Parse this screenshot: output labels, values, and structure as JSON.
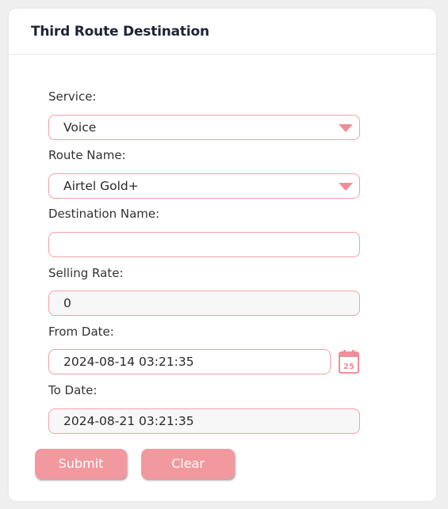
{
  "card": {
    "title": "Third Route Destination"
  },
  "form": {
    "service": {
      "label": "Service:",
      "value": "Voice"
    },
    "route_name": {
      "label": "Route Name:",
      "value": "Airtel Gold+"
    },
    "destination_name": {
      "label": "Destination Name:",
      "value": ""
    },
    "selling_rate": {
      "label": "Selling Rate:",
      "value": "0"
    },
    "from_date": {
      "label": "From Date:",
      "value": "2024-08-14 03:21:35",
      "calendar_icon_day": "25"
    },
    "to_date": {
      "label": "To Date:",
      "value": "2024-08-21 03:21:35"
    }
  },
  "buttons": {
    "submit_label": "Submit",
    "clear_label": "Clear"
  },
  "colors": {
    "accent": "#f1999f",
    "border": "#f2a0a6",
    "title": "#1f2337"
  },
  "icons": {
    "select_caret": "caret-down-icon",
    "calendar": "calendar-icon"
  }
}
